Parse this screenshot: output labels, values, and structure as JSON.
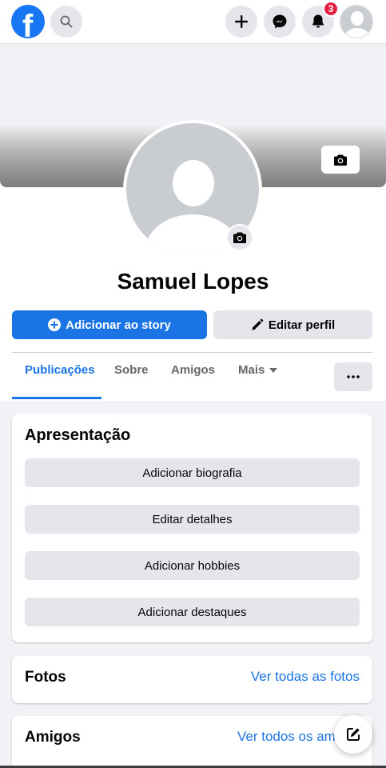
{
  "topbar": {
    "logo_letter": "f",
    "notifications_count": "3"
  },
  "profile": {
    "name": "Samuel Lopes",
    "add_story_label": "Adicionar ao story",
    "edit_profile_label": "Editar perfil"
  },
  "tabs": [
    {
      "label": "Publicações",
      "active": true
    },
    {
      "label": "Sobre",
      "active": false
    },
    {
      "label": "Amigos",
      "active": false
    },
    {
      "label": "Mais",
      "active": false
    }
  ],
  "intro": {
    "title": "Apresentação",
    "buttons": [
      "Adicionar biografia",
      "Editar detalhes",
      "Adicionar hobbies",
      "Adicionar destaques"
    ]
  },
  "photos": {
    "title": "Fotos",
    "link": "Ver todas as fotos"
  },
  "friends": {
    "title": "Amigos",
    "link": "Ver todos os am"
  },
  "colors": {
    "accent": "#1b74e4",
    "badge": "#e41e3f"
  },
  "icons": [
    "facebook-logo",
    "search-icon",
    "plus-icon",
    "messenger-icon",
    "bell-icon",
    "camera-icon",
    "plus-circle-icon",
    "pencil-icon",
    "caret-down-icon",
    "more-dots-icon",
    "compose-icon"
  ]
}
